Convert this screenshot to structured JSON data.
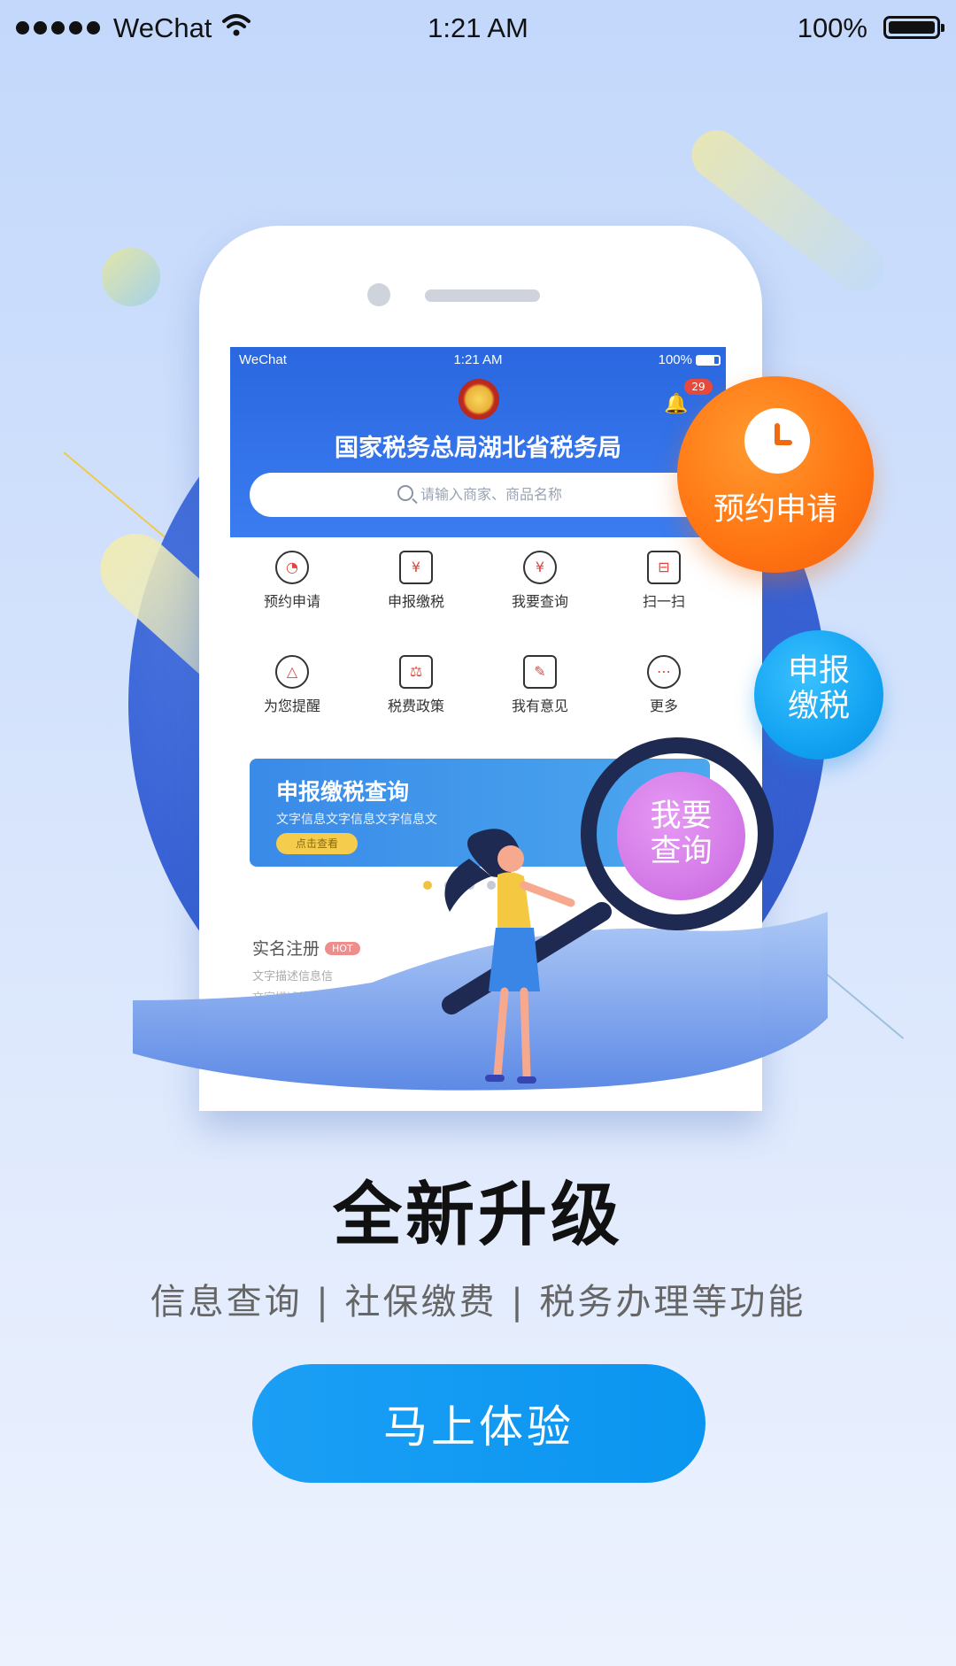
{
  "status_bar": {
    "carrier": "WeChat",
    "time": "1:21 AM",
    "battery": "100%"
  },
  "phone_screen": {
    "status": {
      "carrier": "WeChat",
      "time": "1:21 AM",
      "battery": "100%"
    },
    "notification_count": "29",
    "agency_title": "国家税务总局湖北省税务局",
    "search_placeholder": "请输入商家、商品名称",
    "grid_items": [
      {
        "label": "预约申请",
        "icon": "clock-icon"
      },
      {
        "label": "申报缴税",
        "icon": "house-yen-icon"
      },
      {
        "label": "我要查询",
        "icon": "search-yen-icon"
      },
      {
        "label": "扫一扫",
        "icon": "scan-icon"
      },
      {
        "label": "为您提醒",
        "icon": "bell-icon"
      },
      {
        "label": "税费政策",
        "icon": "scale-icon"
      },
      {
        "label": "我有意见",
        "icon": "edit-icon"
      },
      {
        "label": "更多",
        "icon": "more-icon"
      }
    ],
    "banner": {
      "title": "申报缴税查询",
      "subtitle": "文字信息文字信息文字信息文",
      "button": "点击查看"
    },
    "register": {
      "title": "实名注册",
      "badge": "HOT",
      "line1": "文字描述信息信",
      "line2": "文字描述信息信息"
    }
  },
  "bubbles": {
    "appointment": "预约申请",
    "declare": "申报缴税",
    "query": "我要查询"
  },
  "headline": "全新升级",
  "subline": "信息查询 | 社保缴费 | 税务办理等功能",
  "cta": "马上体验",
  "colors": {
    "orange": "#ff7413",
    "blue": "#12a3f2",
    "purple": "#d57be8",
    "cta": "#0a95f0"
  }
}
